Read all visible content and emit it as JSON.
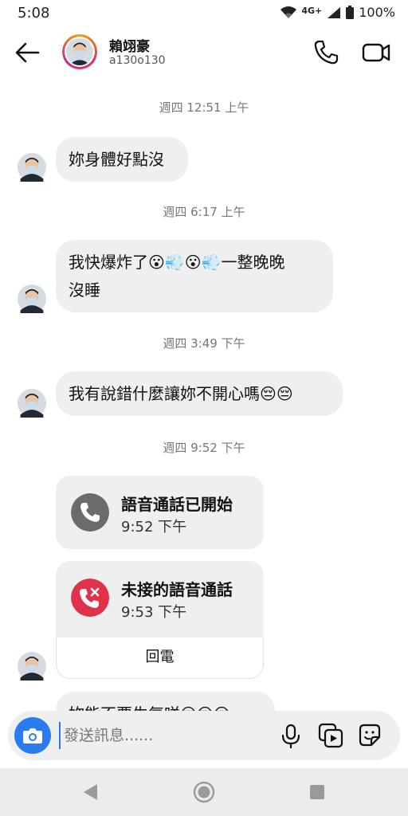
{
  "status": {
    "time": "5:08",
    "network": "4G+",
    "battery": "100%"
  },
  "header": {
    "name": "賴翊豪",
    "username": "a130o130"
  },
  "conversation": {
    "timestamps": [
      "週四 12:51 上午",
      "週四 6:17 上午",
      "週四 3:49 下午",
      "週四 9:52 下午"
    ],
    "messages": [
      {
        "text": "妳身體好點沒"
      },
      {
        "line1": "我快爆炸了😮💨😮💨一整晚晚",
        "line2": "沒睡"
      },
      {
        "text": "我有說錯什麼讓妳不開心嗎😔😔"
      },
      {
        "text": "妳能不要生氣咩😔😔😔"
      }
    ],
    "calls": [
      {
        "title": "語音通話已開始",
        "time": "9:52 下午",
        "icon": "phone-icon"
      },
      {
        "title": "未接的語音通話",
        "time": "9:53 下午",
        "icon": "missed-call-icon",
        "action": "回電"
      }
    ]
  },
  "composer": {
    "placeholder": "發送訊息......"
  },
  "colors": {
    "accent": "#2a7bf0",
    "missed": "#e0334b",
    "call_ok": "#6b6b6b",
    "bubble": "#efefef"
  }
}
